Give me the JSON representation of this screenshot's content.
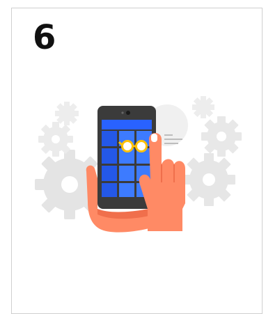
{
  "card": {
    "step_number": "6"
  },
  "illustration": {
    "icons": [
      "gear-icon",
      "smartphone-icon",
      "glasses-icon",
      "hand-icon",
      "finger-tap-icon"
    ],
    "colors": {
      "gears": "#e6e6e6",
      "phone_body": "#3b3b3b",
      "screen_bar": "#2962ff",
      "screen_tiles": "#3d7bff",
      "glasses": "#ffc107",
      "skin": "#ff8a65",
      "skin_shadow": "#f06f4c"
    }
  }
}
